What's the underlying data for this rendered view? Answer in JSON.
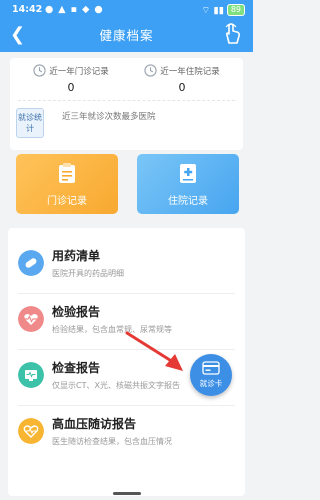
{
  "status_bar": {
    "time": "14:42",
    "battery": "89"
  },
  "header": {
    "title": "健康档案"
  },
  "stats": {
    "outpatient": {
      "label": "近一年门诊记录",
      "value": "0"
    },
    "inpatient": {
      "label": "近一年住院记录",
      "value": "0"
    },
    "badge": "就诊统计",
    "hospital_label": "近三年就诊次数最多医院"
  },
  "cards": [
    {
      "label": "门诊记录"
    },
    {
      "label": "住院记录"
    }
  ],
  "list": [
    {
      "title": "用药清单",
      "desc": "医院开具的药品明细",
      "icon_color": "#5aa8f0"
    },
    {
      "title": "检验报告",
      "desc": "检验结果，包含血常规、尿常规等",
      "icon_color": "#f08a8a"
    },
    {
      "title": "检查报告",
      "desc": "仅显示CT、X光、核磁共振文字报告",
      "icon_color": "#3cc2a8"
    },
    {
      "title": "高血压随访报告",
      "desc": "医生随访检查结果，包含血压情况",
      "icon_color": "#f7b531"
    }
  ],
  "fab": {
    "label": "就诊卡"
  },
  "colors": {
    "primary": "#3ea0f5",
    "card_outpatient": "#f8a930",
    "card_inpatient": "#47a5ef",
    "annotation_arrow": "#e53935"
  }
}
